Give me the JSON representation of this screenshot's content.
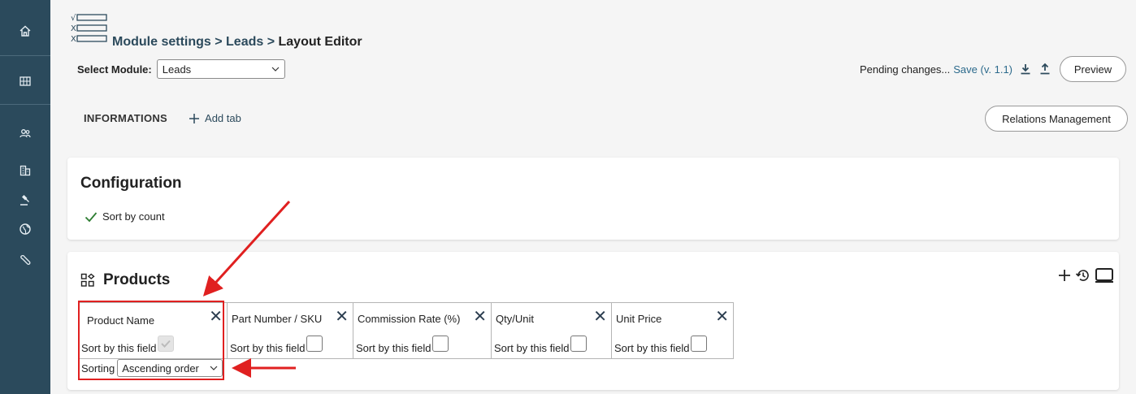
{
  "sidebar": {
    "items": [
      "home-icon",
      "grid-icon",
      "users-icon",
      "building-icon",
      "gavel-icon",
      "globe-icon",
      "wrench-icon"
    ]
  },
  "breadcrumb": {
    "part1": "Module settings",
    "sep1": " > ",
    "part2": "Leads",
    "sep2": " > ",
    "part3": "Layout Editor"
  },
  "module_select": {
    "label": "Select Module:",
    "value": "Leads"
  },
  "pending": {
    "text": "Pending changes...",
    "save": "Save (v. 1.1)"
  },
  "buttons": {
    "preview": "Preview",
    "relations": "Relations Management"
  },
  "tabs": {
    "informations": "INFORMATIONS",
    "add_tab": "Add tab"
  },
  "configuration": {
    "title": "Configuration",
    "sort_by_count": "Sort by count"
  },
  "products": {
    "title": "Products",
    "columns": [
      {
        "name": "Product Name",
        "sort_label": "Sort by this field",
        "checked": true
      },
      {
        "name": "Part Number / SKU",
        "sort_label": "Sort by this field",
        "checked": false
      },
      {
        "name": "Commission Rate (%)",
        "sort_label": "Sort by this field",
        "checked": false
      },
      {
        "name": "Qty/Unit",
        "sort_label": "Sort by this field",
        "checked": false
      },
      {
        "name": "Unit Price",
        "sort_label": "Sort by this field",
        "checked": false
      }
    ],
    "sorting_label": "Sorting",
    "sorting_value": "Ascending order"
  },
  "colors": {
    "sidebar": "#2b4a5c",
    "accent": "#2c4a5c",
    "annotation": "#e02020"
  }
}
